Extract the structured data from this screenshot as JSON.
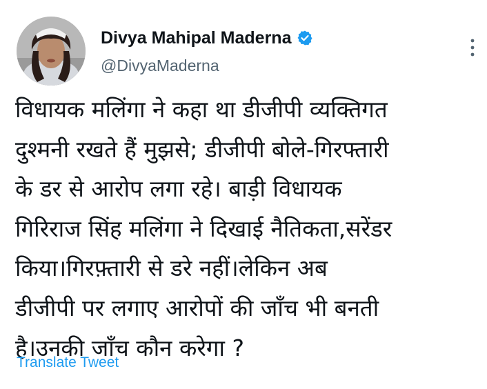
{
  "author": {
    "display_name": "Divya Mahipal Maderna",
    "handle": "@DivyaMaderna",
    "verified": true
  },
  "tweet": {
    "text": "विधायक मलिंगा ने कहा था डीजीपी व्यक्तिगत\nदुश्मनी रखते हैं मुझसे; डीजीपी बोले-गिरफ्तारी\nके डर से आरोप लगा रहे। बाड़ी विधायक\nगिरिराज सिंह मलिंगा ने दिखाई नैतिकता,सरेंडर\nकिया।गिरफ़्तारी से डरे नहीं।लेकिन अब\nडीजीपी पर लगाए आरोपों की जाँच भी बनती\nहै।उनकी जाँच कौन करेगा ?"
  },
  "actions": {
    "translate_label": "Translate Tweet"
  },
  "colors": {
    "accent": "#1d9bf0",
    "secondary_text": "#536471",
    "primary_text": "#0f1419"
  },
  "icons": {
    "verified": "verified-badge-icon",
    "more": "more-options-icon"
  }
}
